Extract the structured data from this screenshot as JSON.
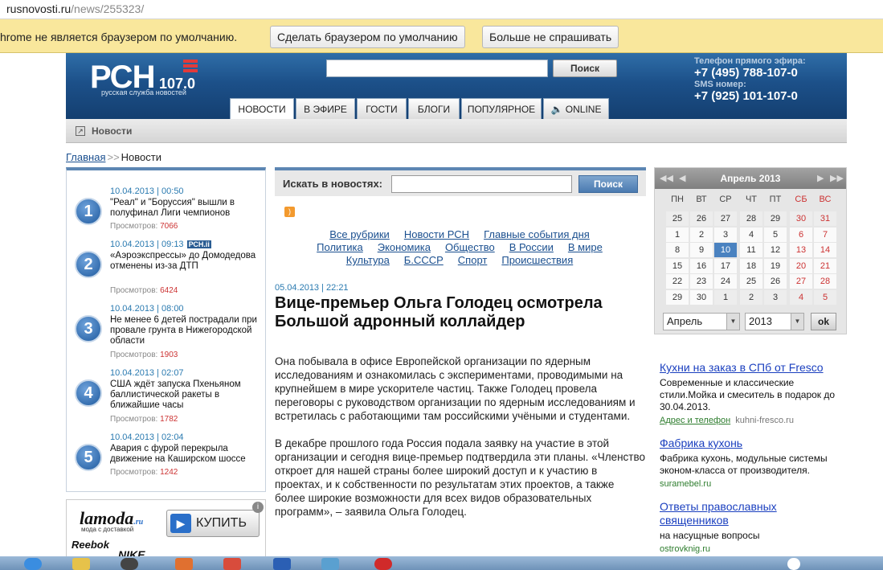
{
  "browser": {
    "url_host": "rusnovosti.ru",
    "url_path": "/news/255323/",
    "infobar_message": "hrome не является браузером по умолчанию.",
    "infobar_btn_default": "Сделать браузером по умолчанию",
    "infobar_btn_never": "Больше не спрашивать"
  },
  "header": {
    "logo_main": "РСН",
    "logo_freq": "107.0",
    "logo_sub": "русская служба новостей",
    "search_button": "Поиск",
    "tabs": [
      "НОВОСТИ",
      "В ЭФИРЕ",
      "ГОСТИ",
      "БЛОГИ",
      "ПОПУЛЯРНОЕ",
      "ONLINE"
    ],
    "phone_label": "Телефон прямого эфира:",
    "phone_number": "+7 (495) 788-107-0",
    "sms_label": "SMS номер:",
    "sms_number": "+7 (925) 101-107-0"
  },
  "subnav": {
    "title": "Новости"
  },
  "breadcrumb": {
    "home": "Главная",
    "sep": ">>",
    "current": "Новости"
  },
  "top_news": [
    {
      "num": "1",
      "date": "10.04.2013 | 00:50",
      "title": "\"Реал\" и \"Боруссия\" вышли в полуфинал Лиги чемпионов",
      "views_label": "Просмотров:",
      "views": "7066"
    },
    {
      "num": "2",
      "date": "10.04.2013 | 09:13",
      "badge": "РСН.ii",
      "title": "«Аэроэкспрессы» до Домодедова отменены из-за ДТП",
      "views_label": "Просмотров:",
      "views": "6424"
    },
    {
      "num": "3",
      "date": "10.04.2013 | 08:00",
      "title": "Не менее 6 детей пострадали при провале грунта в Нижегородской области",
      "views_label": "Просмотров:",
      "views": "1903"
    },
    {
      "num": "4",
      "date": "10.04.2013 | 02:07",
      "title": "США ждёт запуска Пхеньяном баллистической ракеты в ближайшие часы",
      "views_label": "Просмотров:",
      "views": "1782"
    },
    {
      "num": "5",
      "date": "10.04.2013 | 02:04",
      "title": "Авария с фурой перекрыла движение на Каширском шоссе",
      "views_label": "Просмотров:",
      "views": "1242"
    }
  ],
  "banner": {
    "brand": "lamoda",
    "brand_suffix": ".ru",
    "brand_sub": "мода с доставкой",
    "buy": "КУПИТЬ",
    "reebok": "Reebok",
    "nike": "NIKE"
  },
  "news_search": {
    "label": "Искать в новостях:",
    "button": "Поиск"
  },
  "rubrics": {
    "row1": [
      "Все рубрики",
      "Новости РСН",
      "Главные события дня"
    ],
    "row2": [
      "Политика",
      "Экономика",
      "Общество",
      "В России",
      "В мире"
    ],
    "row3": [
      "Культура",
      "Б.СССР",
      "Спорт",
      "Происшествия"
    ]
  },
  "article": {
    "date": "05.04.2013 | 22:21",
    "title": "Вице-премьер Ольга Голодец осмотрела Большой адронный коллайдер",
    "p1": "Она побывала в офисе Европейской организации по ядерным исследованиям и ознакомилась с экспериментами, проводимыми на крупнейшем в мире ускорителе частиц. Также Голодец провела переговоры с руководством организации по ядерным исследованиям и встретилась с работающими там российскими учёными и студентами.",
    "p2": "В декабре прошлого года Россия подала заявку на участие в этой организации и сегодня вице-премьер подтвердила эти планы. «Членство откроет для нашей страны более широкий доступ и к участию в проектах, и к собственности по результатам этих проектов, а также более широкие возможности для всех видов образовательных программ», – заявила Ольга Голодец."
  },
  "calendar": {
    "month_title": "Апрель 2013",
    "weekdays": [
      "ПН",
      "ВТ",
      "СР",
      "ЧТ",
      "ПТ",
      "СБ",
      "ВС"
    ],
    "weeks": [
      [
        "25",
        "26",
        "27",
        "28",
        "29",
        "30",
        "31"
      ],
      [
        "1",
        "2",
        "3",
        "4",
        "5",
        "6",
        "7"
      ],
      [
        "8",
        "9",
        "10",
        "11",
        "12",
        "13",
        "14"
      ],
      [
        "15",
        "16",
        "17",
        "18",
        "19",
        "20",
        "21"
      ],
      [
        "22",
        "23",
        "24",
        "25",
        "26",
        "27",
        "28"
      ],
      [
        "29",
        "30",
        "1",
        "2",
        "3",
        "4",
        "5"
      ]
    ],
    "today": "10",
    "month_select": "Апрель",
    "year_select": "2013",
    "ok": "ok"
  },
  "ads": [
    {
      "title": "Кухни на заказ в СПб от Fresco",
      "desc": "Современные и классические стили.Мойка и смеситель в подарок до 30.04.2013.",
      "extra": "Адрес и телефон",
      "url": "kuhni-fresco.ru"
    },
    {
      "title": "Фабрика кухонь",
      "desc": "Фабрика кухонь, модульные системы эконом-класса от производителя.",
      "extra": "",
      "url": "suramebel.ru"
    },
    {
      "title": "Ответы православных священников",
      "desc": "на насущные вопросы",
      "extra": "",
      "url": "ostrovknig.ru"
    }
  ],
  "colors": {
    "header_blue": "#1c5089",
    "link": "#1a4f8f",
    "date_blue": "#2a7ab0",
    "weekend_red": "#cc3333",
    "infobar": "#f9e79c"
  }
}
